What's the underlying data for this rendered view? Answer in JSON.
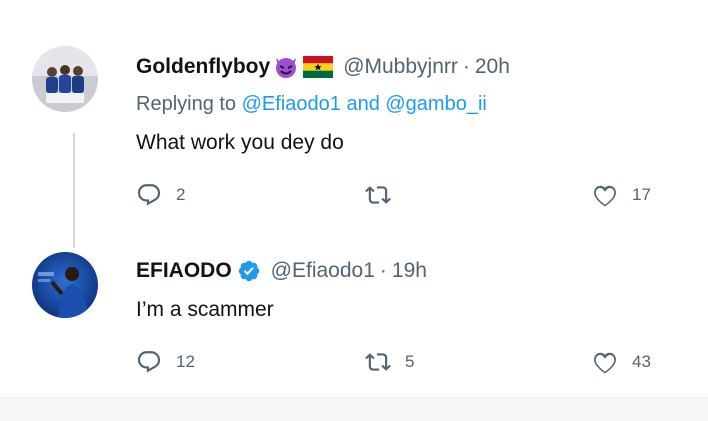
{
  "tweets": [
    {
      "display_name": "Goldenflyboy",
      "handle": "@Mubbyjnrr",
      "separator": "·",
      "time": "20h",
      "emojis": [
        "smiling-devil-emoji",
        "ghana-flag-emoji"
      ],
      "reply_prefix": "Replying to ",
      "mentions": [
        "@Efiaodo1",
        "@gambo_ii"
      ],
      "mention_joiner": " and ",
      "text": "What work you dey do",
      "replies": "2",
      "retweets": "",
      "likes": "17"
    },
    {
      "display_name": "EFIAODO",
      "handle": "@Efiaodo1",
      "separator": "·",
      "time": "19h",
      "verified": true,
      "text": "I’m a scammer",
      "replies": "12",
      "retweets": "5",
      "likes": "43"
    }
  ],
  "colors": {
    "text": "#0f1419",
    "secondary": "#536471",
    "link": "#1d9bf0",
    "verified": "#1d9bf0",
    "thread_line": "#cfd9de"
  }
}
